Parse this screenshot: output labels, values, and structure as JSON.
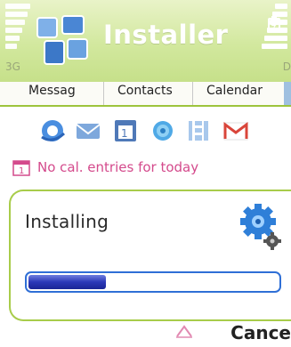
{
  "titlebar": {
    "app_title": "Installer",
    "network_label": "3G",
    "battery_letter": "D",
    "colors": {
      "background": "#d2e89e",
      "title_text": "#ffffff"
    }
  },
  "tabs": [
    {
      "label": "Messag"
    },
    {
      "label": "Contacts"
    },
    {
      "label": "Calendar"
    }
  ],
  "shortcuts": [
    {
      "icon": "browser-icon"
    },
    {
      "icon": "mail-icon"
    },
    {
      "icon": "calendar-icon"
    },
    {
      "icon": "music-icon"
    },
    {
      "icon": "apps-icon"
    },
    {
      "icon": "gmail-icon"
    }
  ],
  "calendar_line": {
    "text": "No cal. entries for today",
    "color": "#d44a8c"
  },
  "dialog": {
    "title": "Installing",
    "progress": 0.31,
    "colors": {
      "border": "#a8cc4a",
      "progress_border": "#2f6fd6",
      "progress_fill": "#2b38b8"
    }
  },
  "softkeys": {
    "right": "Cance"
  }
}
